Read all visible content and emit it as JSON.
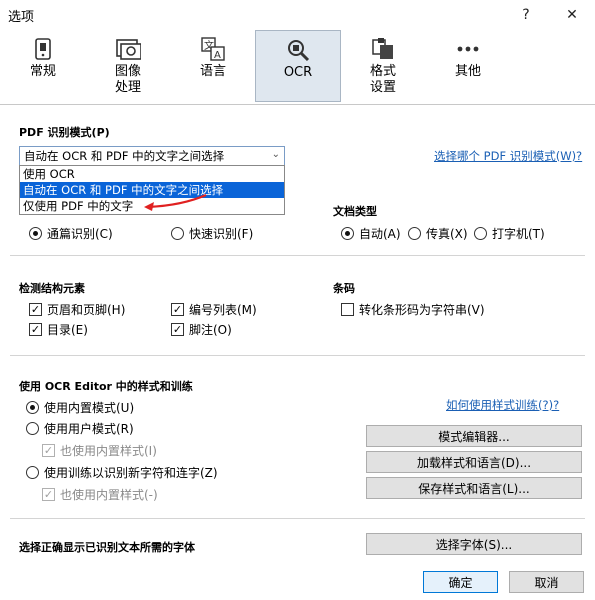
{
  "window": {
    "title": "选项",
    "help_glyph": "?",
    "close_glyph": "✕"
  },
  "toolbar": {
    "items": [
      {
        "label": "常规",
        "icon": "general-icon"
      },
      {
        "label": "图像\n处理",
        "icon": "image-processing-icon"
      },
      {
        "label": "语言",
        "icon": "language-icon"
      },
      {
        "label": "OCR",
        "icon": "ocr-icon",
        "active": true
      },
      {
        "label": "格式\n设置",
        "icon": "format-settings-icon"
      },
      {
        "label": "其他",
        "icon": "more-icon"
      }
    ]
  },
  "pdf_mode": {
    "heading": "PDF 识别模式(P)",
    "selected": "自动在 OCR 和 PDF 中的文字之间选择",
    "options": [
      "使用 OCR",
      "自动在 OCR 和 PDF 中的文字之间选择",
      "仅使用 PDF 中的文字"
    ],
    "help_link": "选择哪个 PDF 识别模式(W)?",
    "annotation_color": "#e02020"
  },
  "recognition": {
    "thorough": "通篇识别(C)",
    "fast": "快速识别(F)"
  },
  "doc_type": {
    "heading": "文档类型",
    "auto": "自动(A)",
    "fax": "传真(X)",
    "typewriter": "打字机(T)"
  },
  "structure": {
    "heading": "检测结构元素",
    "headers_footers": "页眉和页脚(H)",
    "toc": "目录(E)",
    "numbered_lists": "编号列表(M)",
    "footnotes": "脚注(O)"
  },
  "barcode": {
    "heading": "条码",
    "convert": "转化条形码为字符串(V)"
  },
  "training": {
    "heading": "使用 OCR Editor 中的样式和训练",
    "builtin": "使用内置模式(U)",
    "user": "使用用户模式(R)",
    "also_builtin_1": "也使用内置样式(I)",
    "train_new": "使用训练以识别新字符和连字(Z)",
    "also_builtin_2": "也使用内置样式(-)",
    "help_link": "如何使用样式训练(?)?",
    "pattern_editor": "模式编辑器...",
    "load": "加载样式和语言(D)...",
    "save": "保存样式和语言(L)..."
  },
  "fonts": {
    "heading": "选择正确显示已识别文本所需的字体",
    "button": "选择字体(S)..."
  },
  "footer": {
    "ok": "确定",
    "cancel": "取消"
  }
}
